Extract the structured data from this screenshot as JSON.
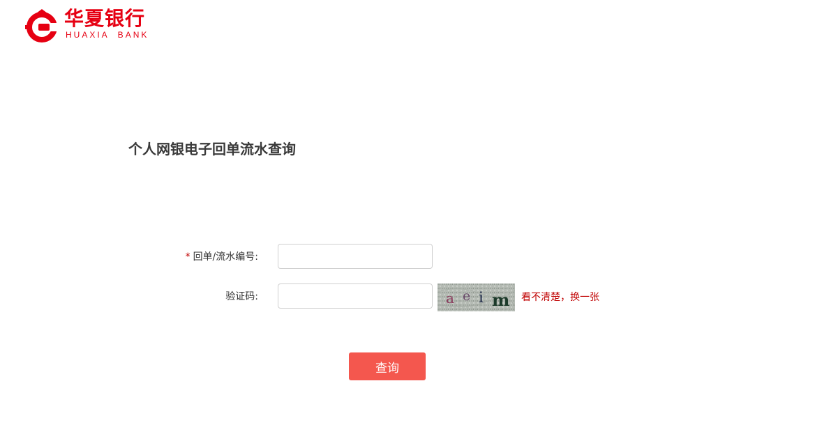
{
  "brand": {
    "name_cn": "华夏银行",
    "name_en": "HUAXIA  BANK",
    "color": "#e60012"
  },
  "page_title": "个人网银电子回单流水查询",
  "form": {
    "serial": {
      "required_mark": "*",
      "label": "回单/流水编号:",
      "value": "",
      "placeholder": ""
    },
    "captcha": {
      "label": "验证码:",
      "value": "",
      "placeholder": "",
      "image_text": [
        "a",
        "e",
        "i",
        "m"
      ],
      "refresh_label": "看不清楚，换一张"
    },
    "submit_label": "查询"
  },
  "colors": {
    "accent_red": "#c00000",
    "button_bg": "#f4574e",
    "title_text": "#3a3a3a"
  }
}
